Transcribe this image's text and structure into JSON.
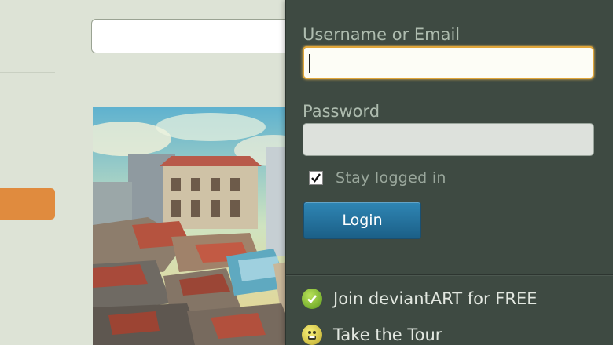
{
  "login": {
    "username_label": "Username or Email",
    "username_value": "",
    "password_label": "Password",
    "password_value": "",
    "stay_logged_in_label": "Stay logged in",
    "stay_logged_in_checked": true,
    "login_button": "Login"
  },
  "links": {
    "join": "Join deviantART for FREE",
    "tour": "Take the Tour"
  },
  "colors": {
    "panel_bg": "#3e4a42",
    "focus_border": "#e0a63a",
    "login_button": "#1f6e99",
    "accent_orange": "#e08b3e",
    "join_icon": "#6faa24",
    "tour_icon": "#d8c83a"
  },
  "icons": {
    "join": "green-check-circle-icon",
    "tour": "smiley-face-icon",
    "checkbox": "checkmark-icon"
  }
}
